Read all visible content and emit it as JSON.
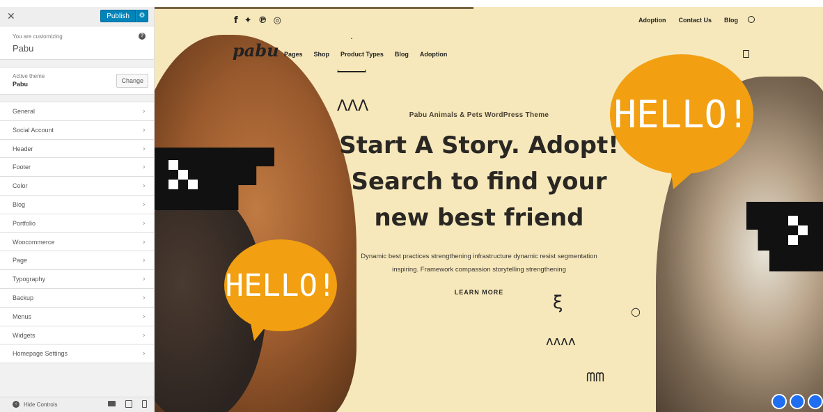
{
  "panel": {
    "close_icon": "close-icon",
    "publish_label": "Publish",
    "customizing_label": "You are customizing",
    "site_name": "Pabu",
    "active_theme_label": "Active theme",
    "theme_name": "Pabu",
    "change_label": "Change",
    "menu_items": [
      "General",
      "Social Account",
      "Header",
      "Footer",
      "Color",
      "Blog",
      "Portfolio",
      "Woocommerce",
      "Page",
      "Typography",
      "Backup",
      "Menus",
      "Widgets",
      "Homepage Settings"
    ],
    "hide_controls": "Hide Controls"
  },
  "preview": {
    "top_links": [
      "Adoption",
      "Contact Us",
      "Blog"
    ],
    "logo": "pabu",
    "main_nav": [
      "Pages",
      "Shop",
      "Product Types",
      "Blog",
      "Adoption"
    ],
    "bubble_text": "HELLO!",
    "tagline": "Pabu Animals & Pets WordPress Theme",
    "headline_1": "Start A Story. Adopt!",
    "headline_2": "Search to find your",
    "headline_3": "new best friend",
    "paragraph_1": "Dynamic best practices strengthening infrastructure dynamic resist segmentation",
    "paragraph_2": "inspiring. Framework compassion storytelling strengthening",
    "cta": "LEARN MORE"
  },
  "colors": {
    "accent": "#0085ba",
    "bubble": "#f29f11",
    "background": "#f6e8bb"
  }
}
